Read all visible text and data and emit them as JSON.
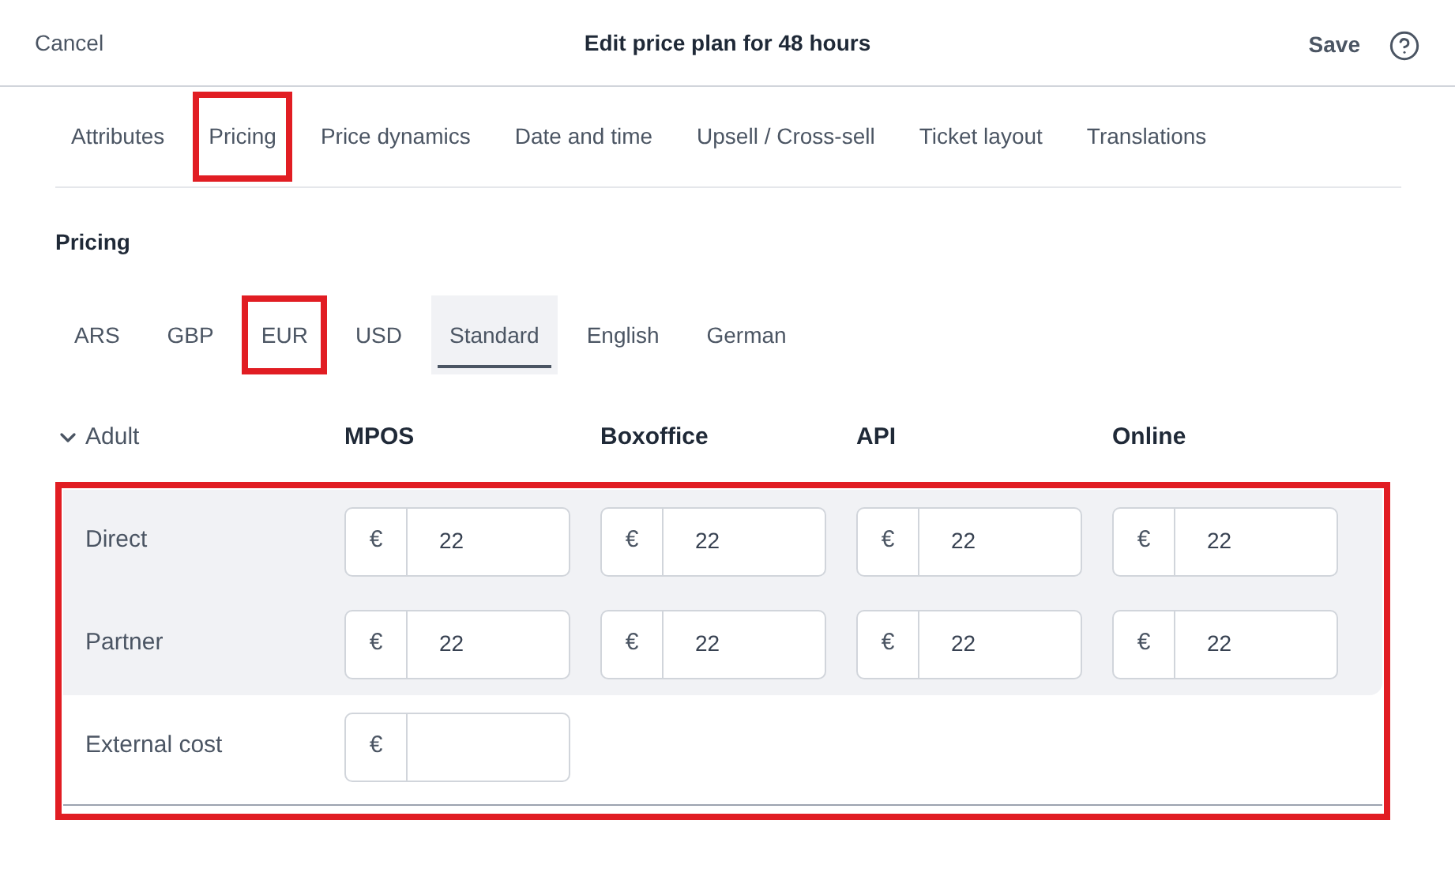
{
  "header": {
    "cancel": "Cancel",
    "title": "Edit price plan for 48 hours",
    "save": "Save"
  },
  "tabs": [
    {
      "label": "Attributes",
      "highlighted": false
    },
    {
      "label": "Pricing",
      "highlighted": true
    },
    {
      "label": "Price dynamics",
      "highlighted": false
    },
    {
      "label": "Date and time",
      "highlighted": false
    },
    {
      "label": "Upsell / Cross-sell",
      "highlighted": false
    },
    {
      "label": "Ticket layout",
      "highlighted": false
    },
    {
      "label": "Translations",
      "highlighted": false
    }
  ],
  "section_title": "Pricing",
  "segments": [
    {
      "label": "ARS",
      "selected": false,
      "highlighted": false
    },
    {
      "label": "GBP",
      "selected": false,
      "highlighted": false
    },
    {
      "label": "EUR",
      "selected": false,
      "highlighted": true
    },
    {
      "label": "USD",
      "selected": false,
      "highlighted": false
    },
    {
      "label": "Standard",
      "selected": true,
      "highlighted": false
    },
    {
      "label": "English",
      "selected": false,
      "highlighted": false
    },
    {
      "label": "German",
      "selected": false,
      "highlighted": false
    }
  ],
  "table": {
    "group": {
      "label": "Adult",
      "expanded": true
    },
    "columns": [
      "MPOS",
      "Boxoffice",
      "API",
      "Online"
    ],
    "highlighted": true,
    "rows": [
      {
        "label": "Direct",
        "shaded": true,
        "cells": [
          {
            "prefix": "€",
            "value": "22"
          },
          {
            "prefix": "€",
            "value": "22"
          },
          {
            "prefix": "€",
            "value": "22"
          },
          {
            "prefix": "€",
            "value": "22"
          }
        ]
      },
      {
        "label": "Partner",
        "shaded": true,
        "cells": [
          {
            "prefix": "€",
            "value": "22"
          },
          {
            "prefix": "€",
            "value": "22"
          },
          {
            "prefix": "€",
            "value": "22"
          },
          {
            "prefix": "€",
            "value": "22"
          }
        ]
      },
      {
        "label": "External cost",
        "shaded": false,
        "cells": [
          {
            "prefix": "€"
          }
        ]
      }
    ]
  }
}
